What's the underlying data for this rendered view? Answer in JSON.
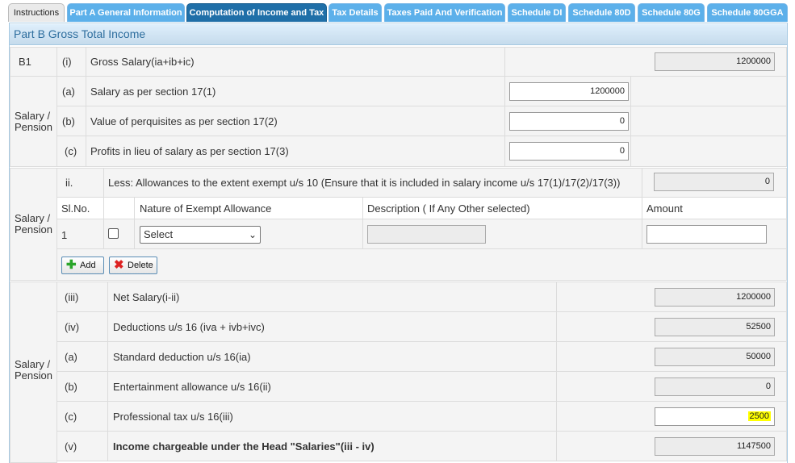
{
  "tabs": [
    {
      "label": "Instructions"
    },
    {
      "label": "Part A General Information"
    },
    {
      "label": "Computation of Income and Tax"
    },
    {
      "label": "Tax Details"
    },
    {
      "label": "Taxes Paid And Verification"
    },
    {
      "label": "Schedule DI"
    },
    {
      "label": "Schedule 80D"
    },
    {
      "label": "Schedule 80G"
    },
    {
      "label": "Schedule 80GGA"
    }
  ],
  "section_title": "Part B Gross Total Income",
  "b1": {
    "code": "B1",
    "num": "(i)",
    "label": "Gross Salary(ia+ib+ic)",
    "value": "1200000"
  },
  "salary_group_label": "Salary / Pension",
  "salary_rows": [
    {
      "num": "(a)",
      "label": "Salary as per section 17(1)",
      "value": "1200000"
    },
    {
      "num": "(b)",
      "label": "Value of perquisites as per section 17(2)",
      "value": "0"
    },
    {
      "num": "(c)",
      "label": "Profits in lieu of salary as per section 17(3)",
      "value": "0"
    }
  ],
  "allowances": {
    "num": "ii.",
    "label": "Less: Allowances to the extent exempt u/s 10 (Ensure that it is included in salary income u/s 17(1)/17(2)/17(3))",
    "value": "0",
    "headers": {
      "slno": "Sl.No.",
      "nature": "Nature of Exempt Allowance",
      "description": "Description ( If Any Other selected)",
      "amount": "Amount"
    },
    "row": {
      "slno": "1",
      "select": "Select",
      "description": "",
      "amount": ""
    },
    "add_label": "Add",
    "delete_label": "Delete"
  },
  "deduction_rows": [
    {
      "num": "(iii)",
      "label": "Net Salary(i-ii)",
      "value": "1200000"
    },
    {
      "num": "(iv)",
      "label": "Deductions u/s 16 (iva + ivb+ivc)",
      "value": "52500"
    },
    {
      "num": "(a)",
      "label": "Standard deduction u/s 16(ia)",
      "value": "50000"
    },
    {
      "num": "(b)",
      "label": "Entertainment allowance u/s 16(ii)",
      "value": "0"
    },
    {
      "num": "(c)",
      "label": "Professional tax u/s 16(iii)",
      "value": "2500"
    },
    {
      "num": "(v)",
      "label": "Income chargeable under the Head \"Salaries\"(iii - iv)",
      "value": "1147500"
    }
  ],
  "colors": {
    "tab": "#5cb0ea",
    "tab_active": "#1f6fa8",
    "header": "#2e6e9e",
    "highlight": "#ffff00"
  }
}
